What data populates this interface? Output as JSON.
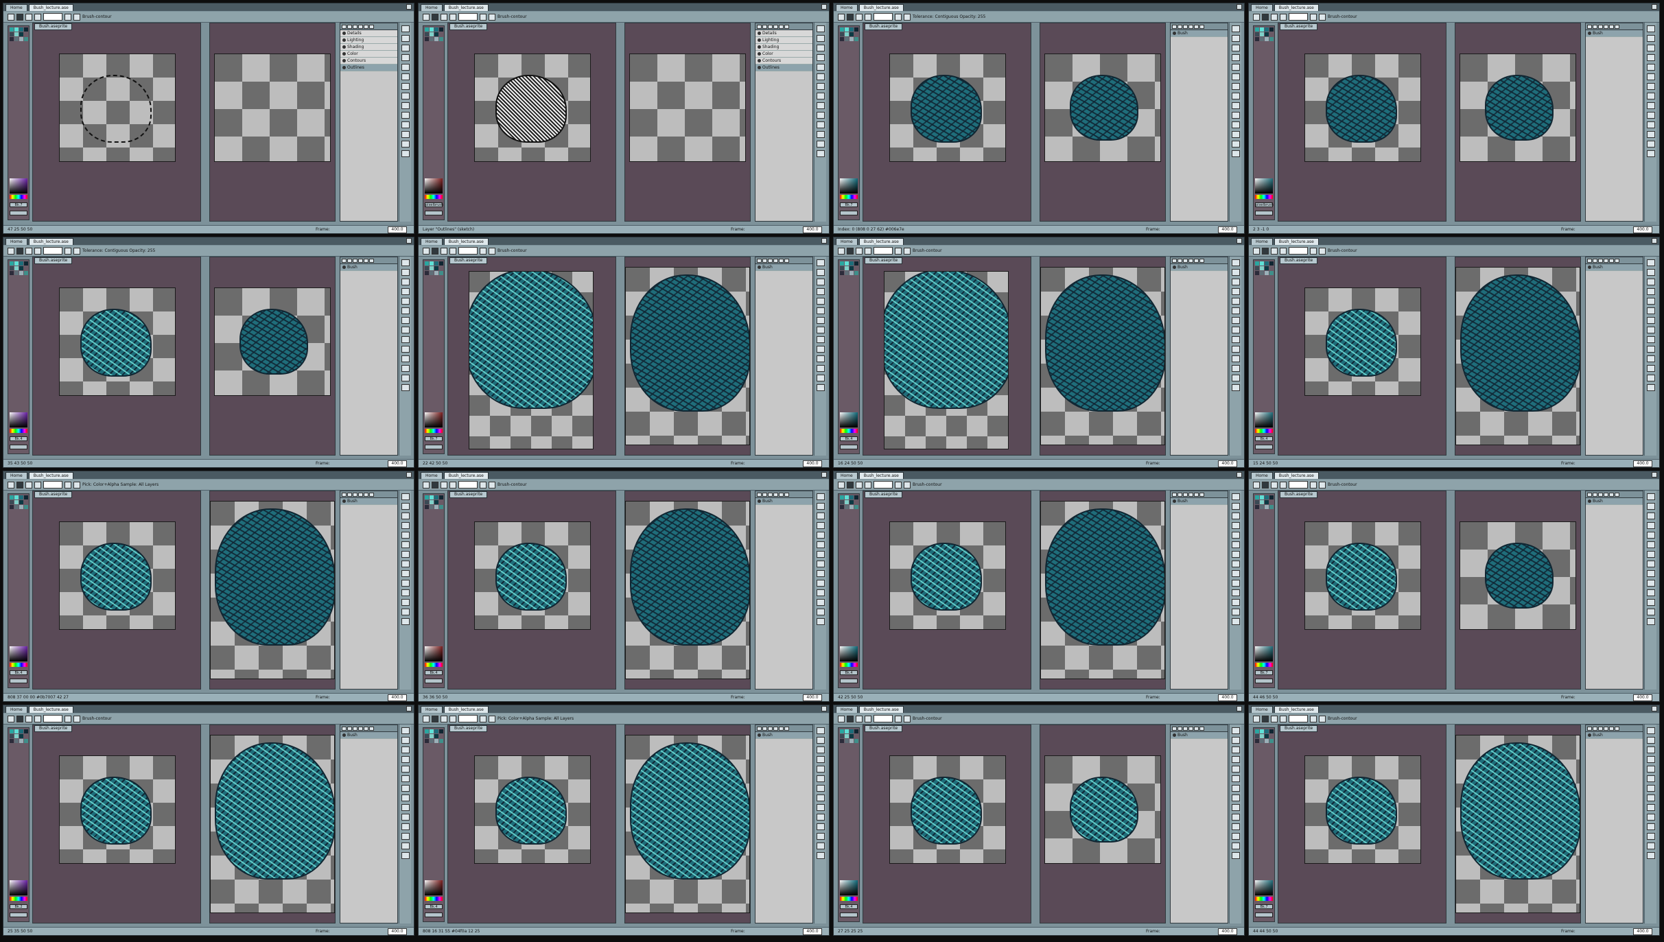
{
  "app": {
    "home_tab": "Home",
    "file_tab": "Bush_lecture.ase",
    "doc_tab": "Bush.aseprite",
    "frame_label": "Frame:",
    "zoom": "400.0"
  },
  "colors": {
    "bush": "#1f6d7a",
    "outline": "#102632",
    "highlight": "#5fe0d6",
    "bg_frame": "#5a4a57",
    "ui": "#7d929a"
  },
  "panels": [
    {
      "stage": "outline",
      "tool_text": "Brush-contour",
      "layers": [
        "Details",
        "Lighting",
        "Shading",
        "Color",
        "Contours",
        "Outlines"
      ],
      "status": "47 25  50 50",
      "button": "Bk.7",
      "right": "empty"
    },
    {
      "stage": "sketch",
      "tool_text": "Brush-contour",
      "layers": [
        "Details",
        "Lighting",
        "Shading",
        "Color",
        "Contours",
        "Outlines"
      ],
      "status": "Layer \"Outlines\" (sketch)",
      "button": "pixelbrush",
      "right": "empty"
    },
    {
      "stage": "teal",
      "tool_text": "Tolerance:  Contiguous   Opacity: 255",
      "layers": [
        "Bush"
      ],
      "status": "Index: 0 (808 0 27 62) #006e7e",
      "button": "Bk.7",
      "right": "teal-sm"
    },
    {
      "stage": "teal",
      "tool_text": "Brush-contour",
      "layers": [
        "Bush"
      ],
      "status": "2 3 -1 0",
      "button": "pixelbrush",
      "right": "teal-sm"
    },
    {
      "stage": "shaded",
      "tool_text": "Tolerance:  Contiguous   Opacity: 255",
      "layers": [
        "Bush"
      ],
      "status": "35 43  50 50",
      "button": "Bk.4",
      "right": "teal-sm"
    },
    {
      "stage": "shaded-big",
      "tool_text": "Brush-contour",
      "layers": [
        "Bush"
      ],
      "status": "22 42  50 50",
      "button": "Bk.7",
      "right": "teal-big"
    },
    {
      "stage": "shaded-big",
      "tool_text": "Brush-contour",
      "layers": [
        "Bush"
      ],
      "status": "16 24  50 50",
      "button": "Bk.4",
      "right": "teal-big"
    },
    {
      "stage": "shaded",
      "tool_text": "Brush-contour",
      "layers": [
        "Bush"
      ],
      "status": "15 24  50 50",
      "button": "Bk.4",
      "right": "teal-big"
    },
    {
      "stage": "shaded",
      "tool_text": "Pick: Color+Alpha  Sample: All Layers",
      "layers": [
        "Bush"
      ],
      "status": "808 37 00 00 #0b7007  42 27",
      "button": "Bk.4",
      "right": "teal-big"
    },
    {
      "stage": "shaded",
      "tool_text": "Brush-contour",
      "layers": [
        "Bush"
      ],
      "status": "36 36  50 50",
      "button": "Bk.4",
      "right": "teal-big"
    },
    {
      "stage": "shaded",
      "tool_text": "Brush-contour",
      "layers": [
        "Bush"
      ],
      "status": "42 25  50 50",
      "button": "Bk.4",
      "right": "teal-big"
    },
    {
      "stage": "shaded",
      "tool_text": "Brush-contour",
      "layers": [
        "Bush"
      ],
      "status": "44 46  50 50",
      "button": "Bk.7",
      "right": "teal-sm"
    },
    {
      "stage": "shaded",
      "tool_text": "Brush-contour",
      "layers": [
        "Bush"
      ],
      "status": "25 35  50 50",
      "button": "Bk.2",
      "right": "shaded-big"
    },
    {
      "stage": "shaded",
      "tool_text": "Pick: Color+Alpha  Sample: All Layers",
      "layers": [
        "Bush"
      ],
      "status": "808 16 31 55 #04f0a  12 25",
      "button": "Bk.4",
      "right": "shaded-big"
    },
    {
      "stage": "shaded",
      "tool_text": "Brush-contour",
      "layers": [
        "Bush"
      ],
      "status": "27 25  25 25",
      "button": "Bk.4",
      "right": "shaded-sm"
    },
    {
      "stage": "shaded",
      "tool_text": "Brush-contour",
      "layers": [
        "Bush"
      ],
      "status": "44 44  50 50",
      "button": "Bk.7",
      "right": "shaded-big"
    }
  ]
}
